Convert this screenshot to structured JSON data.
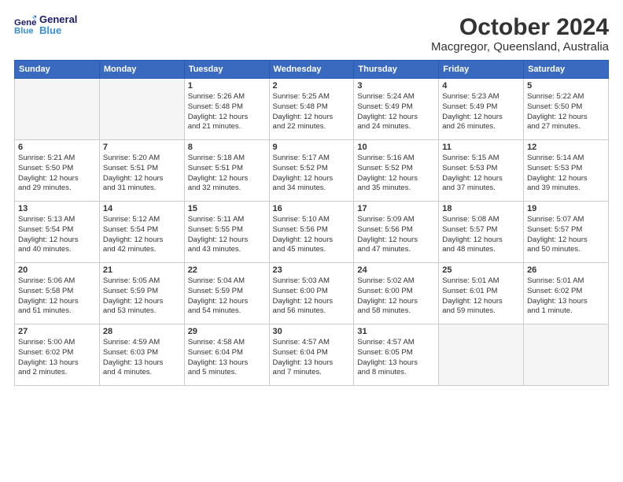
{
  "header": {
    "logo_line1": "General",
    "logo_line2": "Blue",
    "month": "October 2024",
    "location": "Macgregor, Queensland, Australia"
  },
  "days_of_week": [
    "Sunday",
    "Monday",
    "Tuesday",
    "Wednesday",
    "Thursday",
    "Friday",
    "Saturday"
  ],
  "weeks": [
    [
      {
        "day": "",
        "info": ""
      },
      {
        "day": "",
        "info": ""
      },
      {
        "day": "1",
        "info": "Sunrise: 5:26 AM\nSunset: 5:48 PM\nDaylight: 12 hours\nand 21 minutes."
      },
      {
        "day": "2",
        "info": "Sunrise: 5:25 AM\nSunset: 5:48 PM\nDaylight: 12 hours\nand 22 minutes."
      },
      {
        "day": "3",
        "info": "Sunrise: 5:24 AM\nSunset: 5:49 PM\nDaylight: 12 hours\nand 24 minutes."
      },
      {
        "day": "4",
        "info": "Sunrise: 5:23 AM\nSunset: 5:49 PM\nDaylight: 12 hours\nand 26 minutes."
      },
      {
        "day": "5",
        "info": "Sunrise: 5:22 AM\nSunset: 5:50 PM\nDaylight: 12 hours\nand 27 minutes."
      }
    ],
    [
      {
        "day": "6",
        "info": "Sunrise: 5:21 AM\nSunset: 5:50 PM\nDaylight: 12 hours\nand 29 minutes."
      },
      {
        "day": "7",
        "info": "Sunrise: 5:20 AM\nSunset: 5:51 PM\nDaylight: 12 hours\nand 31 minutes."
      },
      {
        "day": "8",
        "info": "Sunrise: 5:18 AM\nSunset: 5:51 PM\nDaylight: 12 hours\nand 32 minutes."
      },
      {
        "day": "9",
        "info": "Sunrise: 5:17 AM\nSunset: 5:52 PM\nDaylight: 12 hours\nand 34 minutes."
      },
      {
        "day": "10",
        "info": "Sunrise: 5:16 AM\nSunset: 5:52 PM\nDaylight: 12 hours\nand 35 minutes."
      },
      {
        "day": "11",
        "info": "Sunrise: 5:15 AM\nSunset: 5:53 PM\nDaylight: 12 hours\nand 37 minutes."
      },
      {
        "day": "12",
        "info": "Sunrise: 5:14 AM\nSunset: 5:53 PM\nDaylight: 12 hours\nand 39 minutes."
      }
    ],
    [
      {
        "day": "13",
        "info": "Sunrise: 5:13 AM\nSunset: 5:54 PM\nDaylight: 12 hours\nand 40 minutes."
      },
      {
        "day": "14",
        "info": "Sunrise: 5:12 AM\nSunset: 5:54 PM\nDaylight: 12 hours\nand 42 minutes."
      },
      {
        "day": "15",
        "info": "Sunrise: 5:11 AM\nSunset: 5:55 PM\nDaylight: 12 hours\nand 43 minutes."
      },
      {
        "day": "16",
        "info": "Sunrise: 5:10 AM\nSunset: 5:56 PM\nDaylight: 12 hours\nand 45 minutes."
      },
      {
        "day": "17",
        "info": "Sunrise: 5:09 AM\nSunset: 5:56 PM\nDaylight: 12 hours\nand 47 minutes."
      },
      {
        "day": "18",
        "info": "Sunrise: 5:08 AM\nSunset: 5:57 PM\nDaylight: 12 hours\nand 48 minutes."
      },
      {
        "day": "19",
        "info": "Sunrise: 5:07 AM\nSunset: 5:57 PM\nDaylight: 12 hours\nand 50 minutes."
      }
    ],
    [
      {
        "day": "20",
        "info": "Sunrise: 5:06 AM\nSunset: 5:58 PM\nDaylight: 12 hours\nand 51 minutes."
      },
      {
        "day": "21",
        "info": "Sunrise: 5:05 AM\nSunset: 5:59 PM\nDaylight: 12 hours\nand 53 minutes."
      },
      {
        "day": "22",
        "info": "Sunrise: 5:04 AM\nSunset: 5:59 PM\nDaylight: 12 hours\nand 54 minutes."
      },
      {
        "day": "23",
        "info": "Sunrise: 5:03 AM\nSunset: 6:00 PM\nDaylight: 12 hours\nand 56 minutes."
      },
      {
        "day": "24",
        "info": "Sunrise: 5:02 AM\nSunset: 6:00 PM\nDaylight: 12 hours\nand 58 minutes."
      },
      {
        "day": "25",
        "info": "Sunrise: 5:01 AM\nSunset: 6:01 PM\nDaylight: 12 hours\nand 59 minutes."
      },
      {
        "day": "26",
        "info": "Sunrise: 5:01 AM\nSunset: 6:02 PM\nDaylight: 13 hours\nand 1 minute."
      }
    ],
    [
      {
        "day": "27",
        "info": "Sunrise: 5:00 AM\nSunset: 6:02 PM\nDaylight: 13 hours\nand 2 minutes."
      },
      {
        "day": "28",
        "info": "Sunrise: 4:59 AM\nSunset: 6:03 PM\nDaylight: 13 hours\nand 4 minutes."
      },
      {
        "day": "29",
        "info": "Sunrise: 4:58 AM\nSunset: 6:04 PM\nDaylight: 13 hours\nand 5 minutes."
      },
      {
        "day": "30",
        "info": "Sunrise: 4:57 AM\nSunset: 6:04 PM\nDaylight: 13 hours\nand 7 minutes."
      },
      {
        "day": "31",
        "info": "Sunrise: 4:57 AM\nSunset: 6:05 PM\nDaylight: 13 hours\nand 8 minutes."
      },
      {
        "day": "",
        "info": ""
      },
      {
        "day": "",
        "info": ""
      }
    ]
  ]
}
